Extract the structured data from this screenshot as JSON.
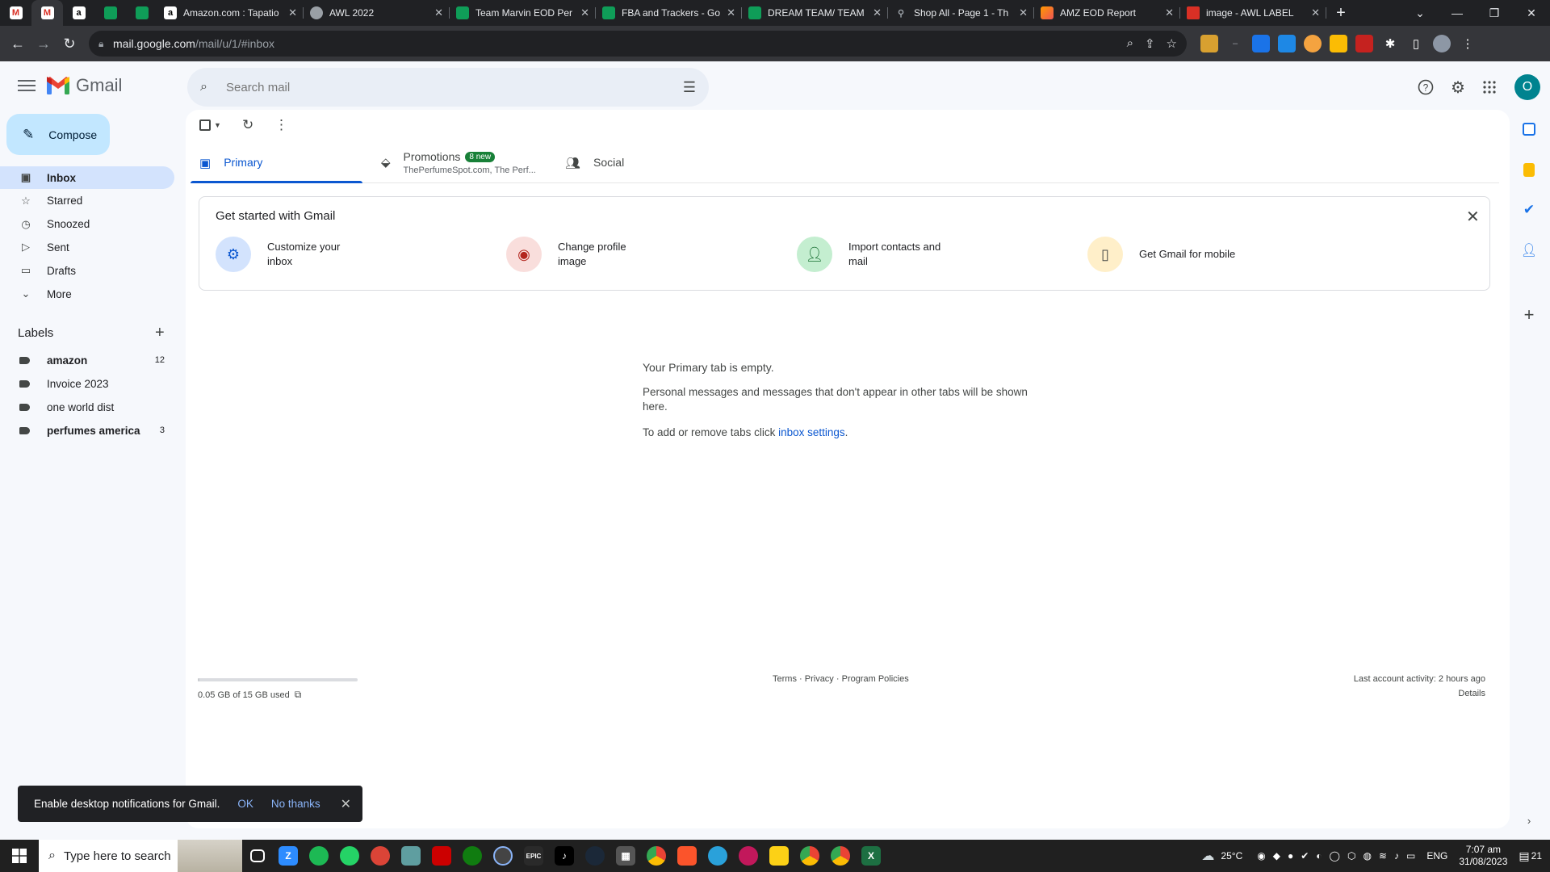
{
  "browser": {
    "tabs": [
      {
        "icon": "gmail-icon",
        "kind": "gm",
        "title": "",
        "glyph": "M",
        "pinned": true
      },
      {
        "icon": "gmail-icon",
        "kind": "gm",
        "title": "",
        "glyph": "M",
        "pinned": true,
        "active": true
      },
      {
        "icon": "amazon-icon",
        "kind": "am",
        "title": "",
        "glyph": "a",
        "pinned": true
      },
      {
        "icon": "sheets-icon",
        "kind": "sh",
        "title": "",
        "glyph": "",
        "pinned": true
      },
      {
        "icon": "sheets-icon",
        "kind": "sh",
        "title": "",
        "glyph": "",
        "pinned": true
      },
      {
        "icon": "amazon-icon",
        "kind": "am",
        "title": "Amazon.com : Tapatio",
        "glyph": "a"
      },
      {
        "icon": "globe-icon",
        "kind": "gl",
        "title": "AWL 2022",
        "glyph": ""
      },
      {
        "icon": "sheets-icon",
        "kind": "sh",
        "title": "Team Marvin EOD Per",
        "glyph": ""
      },
      {
        "icon": "sheets-icon",
        "kind": "sh",
        "title": "FBA and Trackers - Go",
        "glyph": ""
      },
      {
        "icon": "sheets-icon",
        "kind": "sh",
        "title": "DREAM TEAM/ TEAM",
        "glyph": ""
      },
      {
        "icon": "pin-icon",
        "kind": "pin",
        "title": "Shop All - Page 1 - Th",
        "glyph": "⚲"
      },
      {
        "icon": "report-icon",
        "kind": "amz",
        "title": "AMZ EOD Report",
        "glyph": ""
      },
      {
        "icon": "image-icon",
        "kind": "img",
        "title": "image - AWL LABEL",
        "glyph": ""
      }
    ],
    "url_host": "mail.google.com",
    "url_path": "/mail/u/1/#inbox"
  },
  "gmail": {
    "brand": "Gmail",
    "search_placeholder": "Search mail",
    "avatar_letter": "O",
    "compose_label": "Compose",
    "nav": [
      {
        "icon": "inbox-icon",
        "glyph": "▣",
        "label": "Inbox",
        "active": true
      },
      {
        "icon": "star-icon",
        "glyph": "☆",
        "label": "Starred"
      },
      {
        "icon": "clock-icon",
        "glyph": "◷",
        "label": "Snoozed"
      },
      {
        "icon": "send-icon",
        "glyph": "▷",
        "label": "Sent"
      },
      {
        "icon": "draft-icon",
        "glyph": "▭",
        "label": "Drafts"
      },
      {
        "icon": "chevron-down-icon",
        "glyph": "⌄",
        "label": "More"
      }
    ],
    "labels_heading": "Labels",
    "labels": [
      {
        "label": "amazon",
        "count": "12",
        "bold": true
      },
      {
        "label": "Invoice 2023",
        "count": ""
      },
      {
        "label": "one world dist",
        "count": ""
      },
      {
        "label": "perfumes america",
        "count": "3",
        "bold": true
      }
    ],
    "tabs": {
      "primary": "Primary",
      "promotions": "Promotions",
      "promotions_badge": "8 new",
      "promotions_sub": "ThePerfumeSpot.com, The Perf...",
      "social": "Social"
    },
    "get_started": {
      "title": "Get started with Gmail",
      "items": [
        {
          "label": "Customize your inbox",
          "icon": "gear-icon"
        },
        {
          "label": "Change profile image",
          "icon": "profile-icon"
        },
        {
          "label": "Import contacts and mail",
          "icon": "person-add-icon"
        },
        {
          "label": "Get Gmail for mobile",
          "icon": "phone-icon"
        }
      ]
    },
    "empty": {
      "heading": "Your Primary tab is empty.",
      "body": "Personal messages and messages that don't appear in other tabs will be shown here.",
      "tabs_text": "To add or remove tabs click ",
      "tabs_link": "inbox settings",
      "tabs_end": "."
    },
    "footer": {
      "storage": "0.05 GB of 15 GB used",
      "storage_fraction": 0.0033,
      "terms": "Terms",
      "privacy": "Privacy",
      "policies": "Program Policies",
      "sep": "·",
      "activity": "Last account activity: 2 hours ago",
      "details": "Details"
    },
    "toast": {
      "message": "Enable desktop notifications for Gmail.",
      "ok": "OK",
      "no": "No thanks"
    }
  },
  "taskbar": {
    "search_placeholder": "Type here to search",
    "weather": "25°C",
    "lang": "ENG",
    "time": "7:07 am",
    "date": "31/08/2023",
    "notif_count": "21"
  }
}
